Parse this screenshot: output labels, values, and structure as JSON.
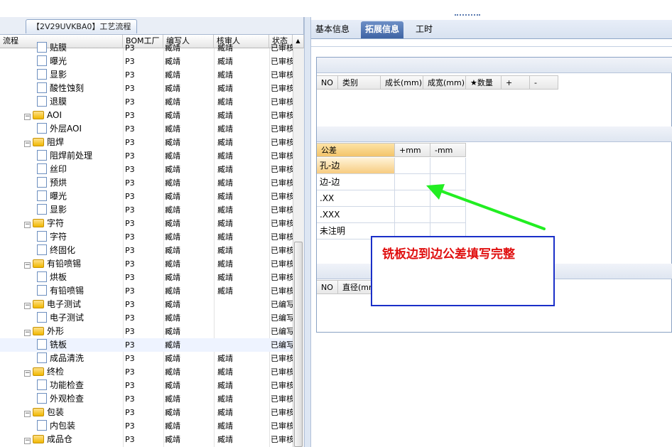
{
  "left_panel": {
    "tab_label": "【2V29UVKBA0】工艺流程",
    "columns": [
      "流程",
      "BOM工厂",
      "编写人",
      "核审人",
      "状态"
    ],
    "rows": [
      {
        "level": 2,
        "type": "doc",
        "name": "贴膜",
        "bom": "P3",
        "writer": "臧靖",
        "reviewer": "臧靖",
        "status": "已审核"
      },
      {
        "level": 2,
        "type": "doc",
        "name": "曝光",
        "bom": "P3",
        "writer": "臧靖",
        "reviewer": "臧靖",
        "status": "已审核"
      },
      {
        "level": 2,
        "type": "doc",
        "name": "显影",
        "bom": "P3",
        "writer": "臧靖",
        "reviewer": "臧靖",
        "status": "已审核"
      },
      {
        "level": 2,
        "type": "doc",
        "name": "酸性蚀刻",
        "bom": "P3",
        "writer": "臧靖",
        "reviewer": "臧靖",
        "status": "已审核"
      },
      {
        "level": 2,
        "type": "doc",
        "name": "退膜",
        "bom": "P3",
        "writer": "臧靖",
        "reviewer": "臧靖",
        "status": "已审核"
      },
      {
        "level": 1,
        "type": "folder",
        "name": "AOI",
        "bom": "P3",
        "writer": "臧靖",
        "reviewer": "臧靖",
        "status": "已审核"
      },
      {
        "level": 2,
        "type": "doc",
        "name": "外层AOI",
        "bom": "P3",
        "writer": "臧靖",
        "reviewer": "臧靖",
        "status": "已审核"
      },
      {
        "level": 1,
        "type": "folder",
        "name": "阻焊",
        "bom": "P3",
        "writer": "臧靖",
        "reviewer": "臧靖",
        "status": "已审核"
      },
      {
        "level": 2,
        "type": "doc",
        "name": "阻焊前处理",
        "bom": "P3",
        "writer": "臧靖",
        "reviewer": "臧靖",
        "status": "已审核"
      },
      {
        "level": 2,
        "type": "doc",
        "name": "丝印",
        "bom": "P3",
        "writer": "臧靖",
        "reviewer": "臧靖",
        "status": "已审核"
      },
      {
        "level": 2,
        "type": "doc",
        "name": "预烘",
        "bom": "P3",
        "writer": "臧靖",
        "reviewer": "臧靖",
        "status": "已审核"
      },
      {
        "level": 2,
        "type": "doc",
        "name": "曝光",
        "bom": "P3",
        "writer": "臧靖",
        "reviewer": "臧靖",
        "status": "已审核"
      },
      {
        "level": 2,
        "type": "doc",
        "name": "显影",
        "bom": "P3",
        "writer": "臧靖",
        "reviewer": "臧靖",
        "status": "已审核"
      },
      {
        "level": 1,
        "type": "folder",
        "name": "字符",
        "bom": "P3",
        "writer": "臧靖",
        "reviewer": "臧靖",
        "status": "已审核"
      },
      {
        "level": 2,
        "type": "doc",
        "name": "字符",
        "bom": "P3",
        "writer": "臧靖",
        "reviewer": "臧靖",
        "status": "已审核"
      },
      {
        "level": 2,
        "type": "doc",
        "name": "终固化",
        "bom": "P3",
        "writer": "臧靖",
        "reviewer": "臧靖",
        "status": "已审核"
      },
      {
        "level": 1,
        "type": "folder",
        "name": "有铅喷锡",
        "bom": "P3",
        "writer": "臧靖",
        "reviewer": "臧靖",
        "status": "已审核"
      },
      {
        "level": 2,
        "type": "doc",
        "name": "烘板",
        "bom": "P3",
        "writer": "臧靖",
        "reviewer": "臧靖",
        "status": "已审核"
      },
      {
        "level": 2,
        "type": "doc",
        "name": "有铅喷锡",
        "bom": "P3",
        "writer": "臧靖",
        "reviewer": "臧靖",
        "status": "已审核"
      },
      {
        "level": 1,
        "type": "folder",
        "name": "电子测试",
        "bom": "P3",
        "writer": "臧靖",
        "reviewer": "",
        "status": "已编写"
      },
      {
        "level": 2,
        "type": "doc",
        "name": "电子测试",
        "bom": "P3",
        "writer": "臧靖",
        "reviewer": "",
        "status": "已编写"
      },
      {
        "level": 1,
        "type": "folder",
        "name": "外形",
        "bom": "P3",
        "writer": "臧靖",
        "reviewer": "",
        "status": "已编写"
      },
      {
        "level": 2,
        "type": "doc",
        "name": "铣板",
        "bom": "P3",
        "writer": "臧靖",
        "reviewer": "",
        "status": "已编写",
        "selected": true
      },
      {
        "level": 2,
        "type": "doc",
        "name": "成品清洗",
        "bom": "P3",
        "writer": "臧靖",
        "reviewer": "臧靖",
        "status": "已审核"
      },
      {
        "level": 1,
        "type": "folder",
        "name": "终检",
        "bom": "P3",
        "writer": "臧靖",
        "reviewer": "臧靖",
        "status": "已审核"
      },
      {
        "level": 2,
        "type": "doc",
        "name": "功能检查",
        "bom": "P3",
        "writer": "臧靖",
        "reviewer": "臧靖",
        "status": "已审核"
      },
      {
        "level": 2,
        "type": "doc",
        "name": "外观检查",
        "bom": "P3",
        "writer": "臧靖",
        "reviewer": "臧靖",
        "status": "已审核"
      },
      {
        "level": 1,
        "type": "folder",
        "name": "包装",
        "bom": "P3",
        "writer": "臧靖",
        "reviewer": "臧靖",
        "status": "已审核"
      },
      {
        "level": 2,
        "type": "doc",
        "name": "内包装",
        "bom": "P3",
        "writer": "臧靖",
        "reviewer": "臧靖",
        "status": "已审核"
      },
      {
        "level": 1,
        "type": "folder",
        "name": "成品仓",
        "bom": "P3",
        "writer": "臧靖",
        "reviewer": "臧靖",
        "status": "已审核"
      }
    ]
  },
  "right_panel": {
    "tabs": [
      "基本信息",
      "拓展信息",
      "工时"
    ],
    "active_tab": 1,
    "grid1_columns": [
      "NO",
      "类别",
      "成长(mm)",
      "成宽(mm)",
      "★数量",
      "+",
      "-"
    ],
    "tolerance": {
      "columns": [
        "公差",
        "+mm",
        "-mm"
      ],
      "rows": [
        "孔-边",
        "边-边",
        ".XX",
        ".XXX",
        "未注明"
      ]
    },
    "grid3_columns": [
      "NO",
      "直径(mm)"
    ]
  },
  "annotation": {
    "text": "铣板边到边公差填写完整",
    "color": "#e01010",
    "border_color": "#1a2fc8",
    "arrow_color": "#22ee22"
  }
}
